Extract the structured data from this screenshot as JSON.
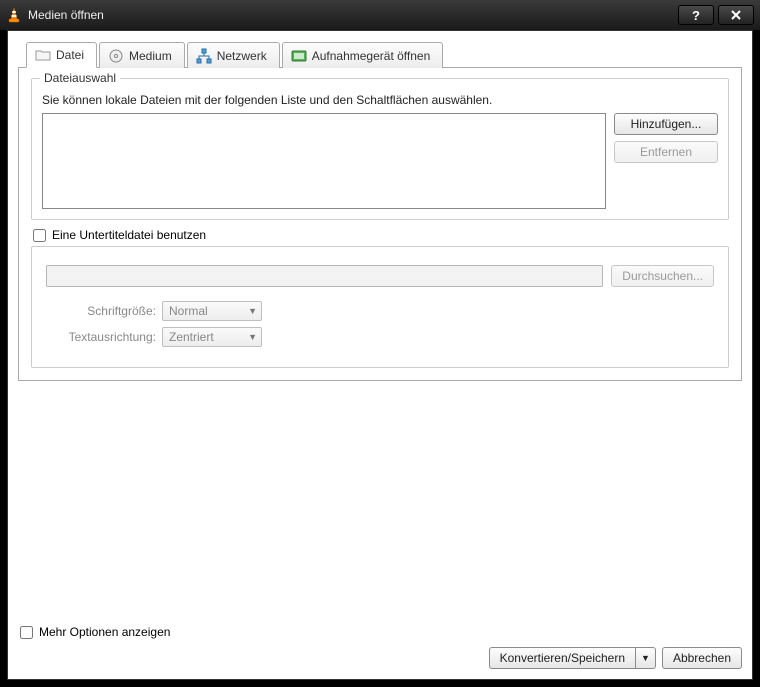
{
  "window": {
    "title": "Medien öffnen"
  },
  "tabs": {
    "file": "Datei",
    "disc": "Medium",
    "network": "Netzwerk",
    "capture": "Aufnahmegerät öffnen"
  },
  "fileGroup": {
    "legend": "Dateiauswahl",
    "help": "Sie können lokale Dateien mit der folgenden Liste und den Schaltflächen auswählen.",
    "add": "Hinzufügen...",
    "remove": "Entfernen"
  },
  "subtitle": {
    "checkbox": "Eine Untertiteldatei benutzen",
    "browse": "Durchsuchen...",
    "fontSizeLabel": "Schriftgröße:",
    "fontSizeValue": "Normal",
    "alignLabel": "Textausrichtung:",
    "alignValue": "Zentriert"
  },
  "footer": {
    "moreOptions": "Mehr Optionen anzeigen",
    "convert": "Konvertieren/Speichern",
    "cancel": "Abbrechen"
  }
}
